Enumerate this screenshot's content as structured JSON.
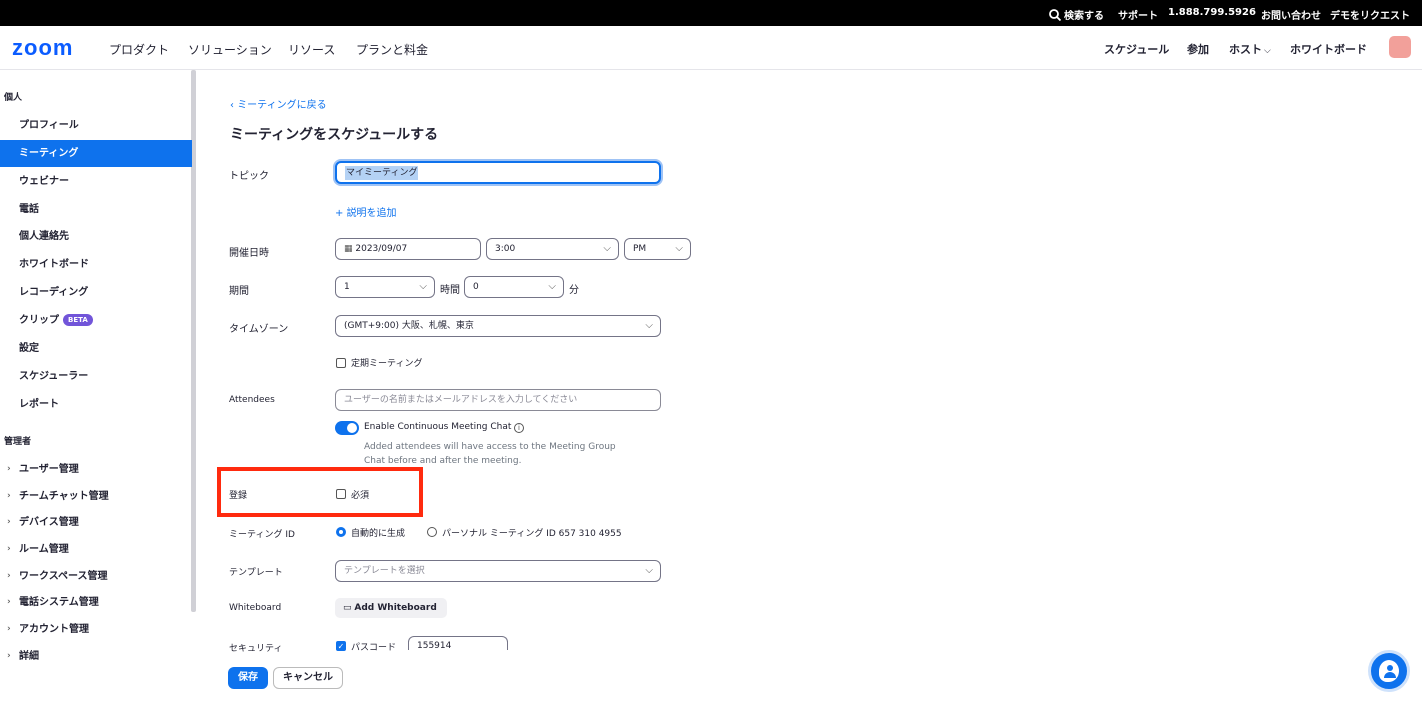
{
  "topbar": {
    "search": "検索する",
    "support": "サポート",
    "phone": "1.888.799.5926",
    "contact": "お問い合わせ",
    "demo": "デモをリクエスト"
  },
  "navbar": {
    "logo": "zoom",
    "items": [
      "プロダクト",
      "ソリューション",
      "リソース",
      "プランと料金"
    ],
    "right": [
      "スケジュール",
      "参加",
      "ホスト",
      "ホワイトボード"
    ]
  },
  "sidebar": {
    "personal_heading": "個人",
    "personal_items": [
      "プロフィール",
      "ミーティング",
      "ウェビナー",
      "電話",
      "個人連絡先",
      "ホワイトボード",
      "レコーディング",
      "クリップ",
      "設定",
      "スケジューラー",
      "レポート"
    ],
    "beta_label": "BETA",
    "admin_heading": "管理者",
    "admin_items": [
      "ユーザー管理",
      "チームチャット管理",
      "デバイス管理",
      "ルーム管理",
      "ワークスペース管理",
      "電話システム管理",
      "アカウント管理",
      "詳細"
    ]
  },
  "form": {
    "back_link": "ミーティングに戻る",
    "title": "ミーティングをスケジュールする",
    "topic_label": "トピック",
    "topic_value": "マイミーティング",
    "add_description": "説明を追加",
    "date_label": "開催日時",
    "date_value": "2023/09/07",
    "time_value": "3:00",
    "ampm_value": "PM",
    "duration_label": "期間",
    "duration_hours": "1",
    "hours_unit": "時間",
    "duration_minutes": "0",
    "minutes_unit": "分",
    "timezone_label": "タイムゾーン",
    "timezone_value": "(GMT+9:00) 大阪、札幌、東京",
    "recurring_label": "定期ミーティング",
    "attendees_label": "Attendees",
    "attendees_placeholder": "ユーザーの名前またはメールアドレスを入力してください",
    "continuous_chat_label": "Enable Continuous Meeting Chat",
    "continuous_chat_note": "Added attendees will have access to the Meeting Group Chat before and after the meeting.",
    "registration_label": "登録",
    "registration_required": "必須",
    "meeting_id_label": "ミーティング ID",
    "meeting_id_auto": "自動的に生成",
    "meeting_id_personal": "パーソナル ミーティング ID 657 310 4955",
    "template_label": "テンプレート",
    "template_placeholder": "テンプレートを選択",
    "whiteboard_label": "Whiteboard",
    "add_whiteboard": "Add Whiteboard",
    "security_label": "セキュリティ",
    "passcode_label": "パスコード",
    "passcode_value": "155914",
    "save": "保存",
    "cancel": "キャンセル"
  },
  "colors": {
    "accent": "#0e72ed",
    "highlight_box": "#ff2a0e"
  }
}
